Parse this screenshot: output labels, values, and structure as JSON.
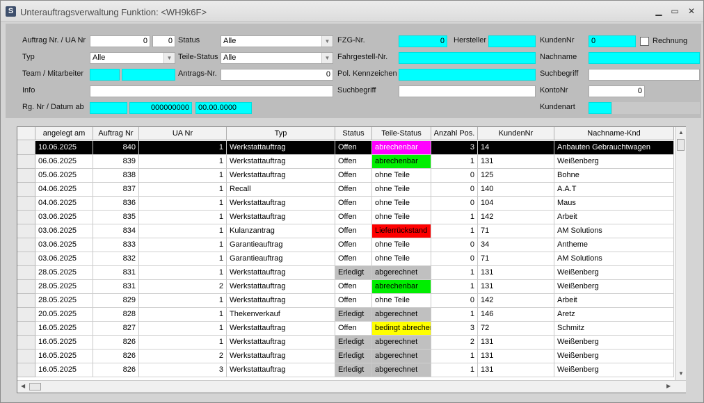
{
  "window": {
    "title": "Unterauftragsverwaltung Funktion: <WH9k6F>"
  },
  "titlebar": {
    "minimize": "▁",
    "maximize": "▭",
    "close": "✕"
  },
  "form": {
    "auftrag_label": "Auftrag Nr. / UA Nr",
    "auftrag_value": "0",
    "ua_value": "0",
    "typ_label": "Typ",
    "typ_value": "Alle",
    "team_label": "Team / Mitarbeiter",
    "info_label": "Info",
    "rg_label": "Rg. Nr / Datum ab",
    "rg_value": "000000000",
    "datum_value": "00.00.0000",
    "status_label": "Status",
    "status_value": "Alle",
    "teile_status_label": "Teile-Status",
    "teile_status_value": "Alle",
    "antrags_label": "Antrags-Nr.",
    "antrags_value": "0",
    "fzg_label": "FZG-Nr.",
    "fzg_value": "0",
    "hersteller_label": "Hersteller",
    "fahrgestell_label": "Fahrgestell-Nr.",
    "kennzeichen_label": "Pol. Kennzeichen",
    "suchbegriff_label": "Suchbegriff",
    "kundennr_label": "KundenNr",
    "kundennr_value": "0",
    "rechnung_label": "Rechnung",
    "nachname_label": "Nachname",
    "suchbegriff2_label": "Suchbegriff",
    "kontonr_label": "KontoNr",
    "kontonr_value": "0",
    "kundenart_label": "Kundenart"
  },
  "grid": {
    "columns": [
      "angelegt am",
      "Auftrag Nr",
      "UA Nr",
      "Typ",
      "Status",
      "Teile-Status",
      "Anzahl Pos.",
      "KundenNr",
      "Nachname-Knd"
    ],
    "rows": [
      [
        "10.06.2025",
        "840",
        "1",
        "Werkstattauftrag",
        "Offen",
        "abrechenbar",
        "3",
        "14",
        "Anbauten Gebrauchtwagen"
      ],
      [
        "06.06.2025",
        "839",
        "1",
        "Werkstattauftrag",
        "Offen",
        "abrechenbar",
        "1",
        "131",
        "Weißenberg"
      ],
      [
        "05.06.2025",
        "838",
        "1",
        "Werkstattauftrag",
        "Offen",
        "ohne Teile",
        "0",
        "125",
        "Bohne"
      ],
      [
        "04.06.2025",
        "837",
        "1",
        "Recall",
        "Offen",
        "ohne Teile",
        "0",
        "140",
        "A.A.T"
      ],
      [
        "04.06.2025",
        "836",
        "1",
        "Werkstattauftrag",
        "Offen",
        "ohne Teile",
        "0",
        "104",
        "Maus"
      ],
      [
        "03.06.2025",
        "835",
        "1",
        "Werkstattauftrag",
        "Offen",
        "ohne Teile",
        "1",
        "142",
        "Arbeit"
      ],
      [
        "03.06.2025",
        "834",
        "1",
        "Kulanzantrag",
        "Offen",
        "Lieferrückstand",
        "1",
        "71",
        "AM Solutions"
      ],
      [
        "03.06.2025",
        "833",
        "1",
        "Garantieauftrag",
        "Offen",
        "ohne Teile",
        "0",
        "34",
        "Antheme"
      ],
      [
        "03.06.2025",
        "832",
        "1",
        "Garantieauftrag",
        "Offen",
        "ohne Teile",
        "0",
        "71",
        "AM Solutions"
      ],
      [
        "28.05.2025",
        "831",
        "1",
        "Werkstattauftrag",
        "Erledigt",
        "abgerechnet",
        "1",
        "131",
        "Weißenberg"
      ],
      [
        "28.05.2025",
        "831",
        "2",
        "Werkstattauftrag",
        "Offen",
        "abrechenbar",
        "1",
        "131",
        "Weißenberg"
      ],
      [
        "28.05.2025",
        "829",
        "1",
        "Werkstattauftrag",
        "Offen",
        "ohne Teile",
        "0",
        "142",
        "Arbeit"
      ],
      [
        "20.05.2025",
        "828",
        "1",
        "Thekenverkauf",
        "Erledigt",
        "abgerechnet",
        "1",
        "146",
        "Aretz"
      ],
      [
        "16.05.2025",
        "827",
        "1",
        "Werkstattauftrag",
        "Offen",
        "bedingt abrechenbar",
        "3",
        "72",
        "Schmitz"
      ],
      [
        "16.05.2025",
        "826",
        "1",
        "Werkstattauftrag",
        "Erledigt",
        "abgerechnet",
        "2",
        "131",
        "Weißenberg"
      ],
      [
        "16.05.2025",
        "826",
        "2",
        "Werkstattauftrag",
        "Erledigt",
        "abgerechnet",
        "1",
        "131",
        "Weißenberg"
      ],
      [
        "16.05.2025",
        "826",
        "3",
        "Werkstattauftrag",
        "Erledigt",
        "abgerechnet",
        "1",
        "131",
        "Weißenberg"
      ]
    ],
    "selected_row": 0
  },
  "colors": {
    "cyan": "#00ffff",
    "teile_abrechenbar": "#00ee00",
    "teile_abrechenbar_selected": "#ff00ff",
    "teile_lieferrueckstand": "#ff0000",
    "teile_bedingt": "#ffff00",
    "teile_abgerechnet": "#c0c0c0",
    "status_erledigt": "#c0c0c0"
  },
  "icons": {
    "app": "app-logo-icon",
    "combo": "chevron-down-icon"
  }
}
